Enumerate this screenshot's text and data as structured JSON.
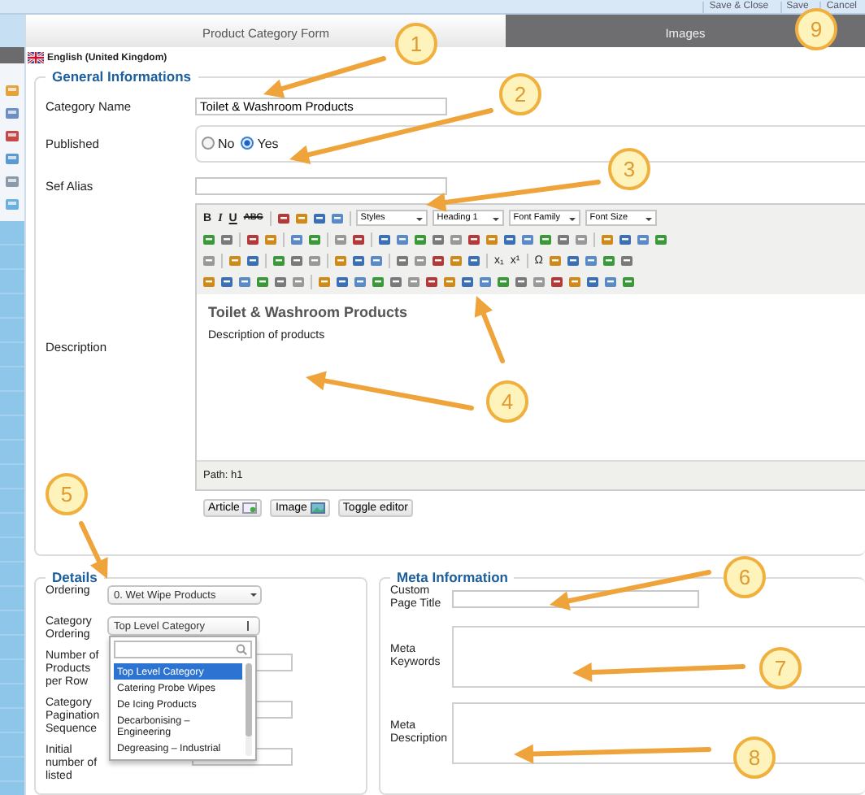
{
  "top_buttons": [
    {
      "label": "Save & Close"
    },
    {
      "label": "Save"
    },
    {
      "label": "Cancel"
    }
  ],
  "tabs": [
    {
      "label": "Product Category Form",
      "selected": true
    },
    {
      "label": "Images",
      "selected": false
    }
  ],
  "language": "English (United Kingdom)",
  "general": {
    "legend": "General Informations",
    "category_name": {
      "label": "Category Name",
      "value": "Toilet & Washroom Products"
    },
    "published": {
      "label": "Published",
      "options": [
        {
          "label": "No",
          "selected": false
        },
        {
          "label": "Yes",
          "selected": true
        }
      ]
    },
    "sef_alias": {
      "label": "Sef Alias"
    },
    "description": {
      "label": "Description",
      "toolbar": [
        [
          {
            "kind": "bold",
            "label": "B"
          },
          {
            "kind": "italic",
            "label": "I"
          },
          {
            "kind": "underline",
            "label": "U"
          },
          {
            "kind": "strike",
            "label": "ABC"
          },
          {
            "kind": "sep"
          },
          {
            "kind": "icon"
          },
          {
            "kind": "icon"
          },
          {
            "kind": "icon"
          },
          {
            "kind": "icon"
          },
          {
            "kind": "sep"
          },
          {
            "kind": "select",
            "label": "Styles"
          },
          {
            "kind": "select",
            "label": "Heading 1"
          },
          {
            "kind": "select",
            "label": "Font Family"
          },
          {
            "kind": "select",
            "label": "Font Size"
          }
        ],
        [
          {
            "kind": "icon"
          },
          {
            "kind": "icon"
          },
          {
            "kind": "sep"
          },
          {
            "kind": "icon"
          },
          {
            "kind": "icon"
          },
          {
            "kind": "sep"
          },
          {
            "kind": "icon"
          },
          {
            "kind": "icon"
          },
          {
            "kind": "sep"
          },
          {
            "kind": "icon"
          },
          {
            "kind": "icon"
          },
          {
            "kind": "sep"
          },
          {
            "kind": "icon"
          },
          {
            "kind": "icon"
          },
          {
            "kind": "icon"
          },
          {
            "kind": "icon"
          },
          {
            "kind": "icon"
          },
          {
            "kind": "icon"
          },
          {
            "kind": "icon"
          },
          {
            "kind": "icon"
          },
          {
            "kind": "icon"
          },
          {
            "kind": "icon"
          },
          {
            "kind": "icon"
          },
          {
            "kind": "icon"
          },
          {
            "kind": "sep"
          },
          {
            "kind": "icon"
          },
          {
            "kind": "icon"
          },
          {
            "kind": "icon"
          },
          {
            "kind": "icon"
          }
        ],
        [
          {
            "kind": "icon"
          },
          {
            "kind": "sep"
          },
          {
            "kind": "icon"
          },
          {
            "kind": "icon"
          },
          {
            "kind": "sep"
          },
          {
            "kind": "icon"
          },
          {
            "kind": "icon"
          },
          {
            "kind": "icon"
          },
          {
            "kind": "sep"
          },
          {
            "kind": "icon"
          },
          {
            "kind": "icon"
          },
          {
            "kind": "icon"
          },
          {
            "kind": "sep"
          },
          {
            "kind": "icon"
          },
          {
            "kind": "icon"
          },
          {
            "kind": "icon"
          },
          {
            "kind": "icon"
          },
          {
            "kind": "icon"
          },
          {
            "kind": "sep"
          },
          {
            "kind": "text",
            "label": "x₁"
          },
          {
            "kind": "text",
            "label": "x¹"
          },
          {
            "kind": "sep"
          },
          {
            "kind": "text",
            "label": "Ω"
          },
          {
            "kind": "icon"
          },
          {
            "kind": "icon"
          },
          {
            "kind": "icon"
          },
          {
            "kind": "icon"
          },
          {
            "kind": "icon"
          }
        ],
        [
          {
            "kind": "icon"
          },
          {
            "kind": "icon"
          },
          {
            "kind": "icon"
          },
          {
            "kind": "icon"
          },
          {
            "kind": "icon"
          },
          {
            "kind": "icon"
          },
          {
            "kind": "sep"
          },
          {
            "kind": "icon"
          },
          {
            "kind": "icon"
          },
          {
            "kind": "icon"
          },
          {
            "kind": "icon"
          },
          {
            "kind": "icon"
          },
          {
            "kind": "icon"
          },
          {
            "kind": "icon"
          },
          {
            "kind": "icon"
          },
          {
            "kind": "icon"
          },
          {
            "kind": "icon"
          },
          {
            "kind": "icon"
          },
          {
            "kind": "icon"
          },
          {
            "kind": "icon"
          },
          {
            "kind": "icon"
          },
          {
            "kind": "icon"
          },
          {
            "kind": "icon"
          },
          {
            "kind": "icon"
          },
          {
            "kind": "icon"
          }
        ]
      ],
      "heading": "Toilet & Washroom Products",
      "text": "Description of products",
      "path": "Path: h1",
      "buttons": [
        {
          "label": "Article",
          "kind": "article"
        },
        {
          "label": "Image",
          "kind": "image"
        },
        {
          "label": "Toggle editor",
          "kind": "plain"
        }
      ]
    }
  },
  "details": {
    "legend": "Details",
    "fields": [
      {
        "label": "Ordering",
        "kind": "select",
        "value": "0. Wet Wipe Products"
      },
      {
        "label": "Category Ordering",
        "kind": "open-select",
        "value": "Top Level Category",
        "options": [
          {
            "label": "Top Level Category",
            "selected": true
          },
          {
            "label": "Catering Probe Wipes",
            "selected": false
          },
          {
            "label": "De Icing Products",
            "selected": false
          },
          {
            "label": "Decarbonising – Engineering",
            "selected": false
          },
          {
            "label": "Degreasing – Industrial",
            "selected": false
          }
        ]
      },
      {
        "label": "Number of Products per Row",
        "kind": "input"
      },
      {
        "label": "Category Pagination Sequence",
        "kind": "input"
      },
      {
        "label": "Initial number of listed",
        "kind": "input"
      }
    ]
  },
  "meta": {
    "legend": "Meta Information",
    "fields": [
      {
        "label": "Custom Page Title",
        "kind": "input"
      },
      {
        "label": "Meta Keywords",
        "kind": "textarea"
      },
      {
        "label": "Meta Description",
        "kind": "textarea"
      }
    ]
  },
  "callouts": [
    "1",
    "2",
    "3",
    "4",
    "5",
    "6",
    "7",
    "8",
    "9"
  ]
}
